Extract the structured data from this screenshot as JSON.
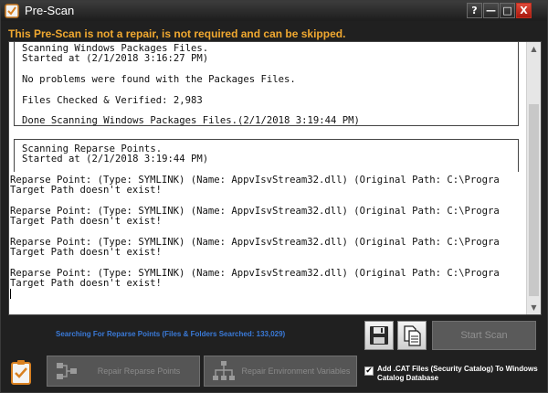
{
  "window": {
    "title": "Pre-Scan",
    "controls": {
      "help": "?",
      "minimize": "—",
      "maximize": "□",
      "close": "X"
    }
  },
  "warning": "This Pre-Scan is not a repair, is not required and can be skipped.",
  "log": {
    "block1": [
      "Scanning Windows Packages Files.",
      "Started at (2/1/2018 3:16:27 PM)",
      "No problems were found with the Packages Files.",
      "Files Checked & Verified: 2,983",
      "Done Scanning Windows Packages Files.(2/1/2018 3:19:44 PM)"
    ],
    "block2": [
      "Scanning Reparse Points.",
      "Started at (2/1/2018 3:19:44 PM)"
    ],
    "entries": [
      {
        "line1": "Reparse Point: (Type: SYMLINK) (Name: AppvIsvStream32.dll) (Original Path: C:\\Progra",
        "line2": "Target Path doesn't exist!"
      },
      {
        "line1": "Reparse Point: (Type: SYMLINK) (Name: AppvIsvStream32.dll) (Original Path: C:\\Progra",
        "line2": "Target Path doesn't exist!"
      },
      {
        "line1": "Reparse Point: (Type: SYMLINK) (Name: AppvIsvStream32.dll) (Original Path: C:\\Progra",
        "line2": "Target Path doesn't exist!"
      },
      {
        "line1": "Reparse Point: (Type: SYMLINK) (Name: AppvIsvStream32.dll) (Original Path: C:\\Progra",
        "line2": "Target Path doesn't exist!"
      }
    ]
  },
  "status": "Searching For Reparse Points (Files & Folders Searched: 133,029)",
  "buttons": {
    "start_scan": "Start Scan",
    "repair_reparse": "Repair Reparse Points",
    "repair_env": "Repair Environment Variables"
  },
  "cat_option": {
    "label": "Add .CAT Files (Security Catalog) To Windows Catalog Database",
    "checked": true
  },
  "colors": {
    "warning": "#f0a830",
    "status": "#3a7ad8",
    "close_button": "#c8281a"
  }
}
